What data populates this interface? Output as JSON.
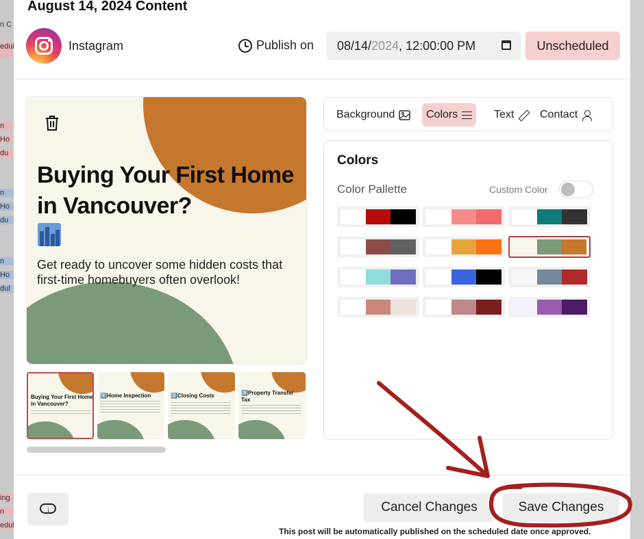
{
  "modal": {
    "title": "August 14, 2024 Content",
    "platform": "Instagram",
    "publish_label": "Publish on",
    "datetime": {
      "month_day": "08/14/",
      "year": "2024",
      "time": ", 12:00:00 PM"
    },
    "status": "Unscheduled"
  },
  "preview": {
    "heading": "Buying Your First Home in Vancouver?",
    "body": "Get ready to uncover some hidden costs that first-time homebuyers often overlook!",
    "thumbnails": [
      {
        "title": "Buying Your First Home in Vancouver?"
      },
      {
        "title": "1️⃣Home Inspection"
      },
      {
        "title": "2️⃣Closing Costs"
      },
      {
        "title": "3️⃣Property Transfer Tax"
      }
    ]
  },
  "tabs": [
    {
      "label": "Background",
      "icon": "image-icon"
    },
    {
      "label": "Colors",
      "icon": "sliders-icon",
      "active": true
    },
    {
      "label": "Text",
      "icon": "pencil-icon"
    },
    {
      "label": "Contact",
      "icon": "person-icon"
    }
  ],
  "colors_panel": {
    "title": "Colors",
    "palette_label": "Color Pallette",
    "custom_label": "Custom Color",
    "custom_enabled": false,
    "selected_index": 5,
    "palettes": [
      [
        "#ffffff",
        "#b80c0c",
        "#000000"
      ],
      [
        "#ffffff",
        "#f88a8a",
        "#f26b6b"
      ],
      [
        "#ffffff",
        "#0d7b7c",
        "#333333"
      ],
      [
        "#ffffff",
        "#8c4d49",
        "#616161"
      ],
      [
        "#ffffff",
        "#e8a43a",
        "#f97314"
      ],
      [
        "#f8f6ea",
        "#7b9a7a",
        "#c6772e"
      ],
      [
        "#ffffff",
        "#8fdcdc",
        "#6f6fbd"
      ],
      [
        "#ffffff",
        "#3a63de",
        "#000000"
      ],
      [
        "#f7f7f9",
        "#74899b",
        "#b02a2a"
      ],
      [
        "#ffffff",
        "#c8897a",
        "#ede1dc"
      ],
      [
        "#ffffff",
        "#bf8888",
        "#7a1f1f"
      ],
      [
        "#f4f1fa",
        "#9a5bb1",
        "#4b1c64"
      ]
    ]
  },
  "footer": {
    "cancel_label": "Cancel Changes",
    "save_label": "Save Changes",
    "note": "This post will be automatically published on the scheduled date once approved."
  },
  "background_fragments": [
    "n C",
    "edul",
    "n",
    "Ho",
    "du",
    "n",
    "Ho",
    "du",
    "n",
    "Ho",
    "dul",
    "ing",
    "n",
    "edul"
  ],
  "annotation_color": "#a41f1f"
}
